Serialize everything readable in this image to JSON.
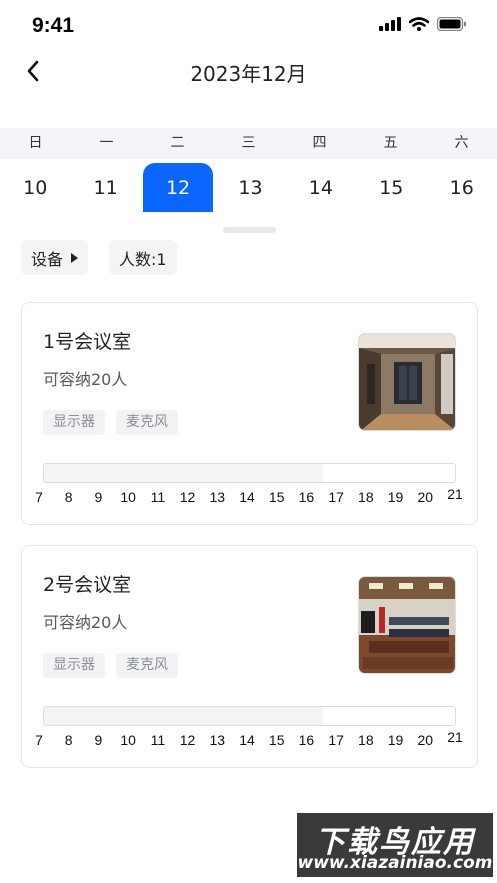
{
  "status_bar": {
    "time": "9:41"
  },
  "header": {
    "title": "2023年12月"
  },
  "calendar": {
    "weekdays": [
      "日",
      "一",
      "二",
      "三",
      "四",
      "五",
      "六"
    ],
    "dates": [
      "10",
      "11",
      "12",
      "13",
      "14",
      "15",
      "16"
    ],
    "selected_date": "12",
    "accent_color": "#0a66ff"
  },
  "filters": {
    "equipment_label": "设备",
    "people_label": "人数:1"
  },
  "rooms": [
    {
      "name": "1号会议室",
      "capacity": "可容纳20人",
      "tags": [
        "显示器",
        "麦克风"
      ],
      "timeline_labels": [
        "7",
        "8",
        "9",
        "10",
        "11",
        "12",
        "13",
        "14",
        "15",
        "16",
        "17",
        "18",
        "19",
        "20",
        "21"
      ],
      "booked_fraction": 0.68
    },
    {
      "name": "2号会议室",
      "capacity": "可容纳20人",
      "tags": [
        "显示器",
        "麦克风"
      ],
      "timeline_labels": [
        "7",
        "8",
        "9",
        "10",
        "11",
        "12",
        "13",
        "14",
        "15",
        "16",
        "17",
        "18",
        "19",
        "20",
        "21"
      ],
      "booked_fraction": 0.68
    }
  ],
  "watermark": {
    "title": "下载鸟应用",
    "url": "www.xiazainiao.com"
  }
}
